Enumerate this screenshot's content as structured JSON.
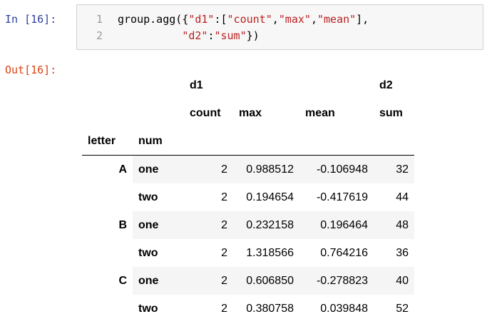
{
  "input_cell": {
    "prompt": "In [16]:",
    "line_numbers": [
      "1",
      "2"
    ],
    "code_lines": [
      [
        {
          "t": "group.agg({",
          "k": "plain"
        },
        {
          "t": "\"d1\"",
          "k": "str"
        },
        {
          "t": ":[",
          "k": "plain"
        },
        {
          "t": "\"count\"",
          "k": "str"
        },
        {
          "t": ",",
          "k": "plain"
        },
        {
          "t": "\"max\"",
          "k": "str"
        },
        {
          "t": ",",
          "k": "plain"
        },
        {
          "t": "\"mean\"",
          "k": "str"
        },
        {
          "t": "],",
          "k": "plain"
        }
      ],
      [
        {
          "t": "          ",
          "k": "plain"
        },
        {
          "t": "\"d2\"",
          "k": "str"
        },
        {
          "t": ":",
          "k": "plain"
        },
        {
          "t": "\"sum\"",
          "k": "str"
        },
        {
          "t": "})",
          "k": "plain"
        }
      ]
    ]
  },
  "output_cell": {
    "prompt": "Out[16]:",
    "table": {
      "header_level0": [
        "d1",
        "d2"
      ],
      "header_level1": [
        "count",
        "max",
        "mean",
        "sum"
      ],
      "index_names": [
        "letter",
        "num"
      ],
      "rows": [
        {
          "letter": "A",
          "num": "one",
          "values": [
            "2",
            "0.988512",
            "-0.106948",
            "32"
          ]
        },
        {
          "letter": "",
          "num": "two",
          "values": [
            "2",
            "0.194654",
            "-0.417619",
            "44"
          ]
        },
        {
          "letter": "B",
          "num": "one",
          "values": [
            "2",
            "0.232158",
            "0.196464",
            "48"
          ]
        },
        {
          "letter": "",
          "num": "two",
          "values": [
            "2",
            "1.318566",
            "0.764216",
            "36"
          ]
        },
        {
          "letter": "C",
          "num": "one",
          "values": [
            "2",
            "0.606850",
            "-0.278823",
            "40"
          ]
        },
        {
          "letter": "",
          "num": "two",
          "values": [
            "2",
            "0.380758",
            "0.039848",
            "52"
          ]
        }
      ]
    }
  },
  "colors": {
    "in_prompt": "#303f9f",
    "out_prompt": "#d84315",
    "string": "#ba2121",
    "cell_background": "#f7f7f7",
    "stripe": "#f5f5f5"
  }
}
